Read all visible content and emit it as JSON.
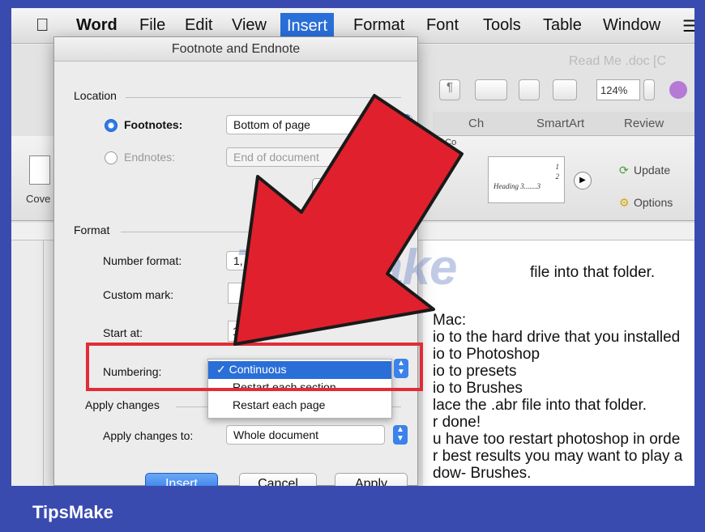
{
  "menubar": {
    "items": [
      "Word",
      "File",
      "Edit",
      "View",
      "Insert",
      "Format",
      "Font",
      "Tools",
      "Table",
      "Window"
    ],
    "active": "Insert"
  },
  "document": {
    "title": "Read Me .doc [C",
    "zoom": "124%",
    "lines": [
      "file into that folder.",
      "Mac:",
      "io to the hard drive that you installed",
      "io to Photoshop",
      "io to presets",
      "io to Brushes",
      "lace the .abr file into that folder.",
      "r done!",
      "u have too restart photoshop in orde",
      "r best results you may want to play a",
      "dow- Brushes."
    ]
  },
  "ribbon": {
    "tabs": [
      "Ch",
      "SmartArt",
      "Review"
    ],
    "toc_group_label": "of Co",
    "toc_sample": [
      "1",
      "2",
      "Heading 3.......3"
    ],
    "update_label": "Update",
    "options_label": "Options",
    "cover_label": "Cove"
  },
  "dialog": {
    "title": "Footnote and Endnote",
    "location_label": "Location",
    "footnotes_label": "Footnotes:",
    "footnotes_value": "Bottom of page",
    "endnotes_label": "Endnotes:",
    "endnotes_value": "End of document",
    "convert_partial": "C",
    "format_label": "Format",
    "number_format_label": "Number format:",
    "number_format_value": "1, 2, 3, ...",
    "custom_mark_label": "Custom mark:",
    "start_at_label": "Start at:",
    "start_at_value": "1",
    "numbering_label": "Numbering:",
    "numbering_options": [
      "Continuous",
      "Restart each section",
      "Restart each page"
    ],
    "numbering_selected": "Continuous",
    "apply_changes_label": "Apply changes",
    "apply_changes_to_label": "Apply changes to:",
    "apply_changes_to_value": "Whole document",
    "insert_button": "Insert",
    "cancel_button": "Cancel",
    "apply_button": "Apply"
  },
  "overlay": {
    "watermark": "TipsMake",
    "brand": "TipsMake",
    "arrow_color": "#e0202c",
    "highlight_color": "#e02c36",
    "frame_color": "#3a4bb0"
  }
}
